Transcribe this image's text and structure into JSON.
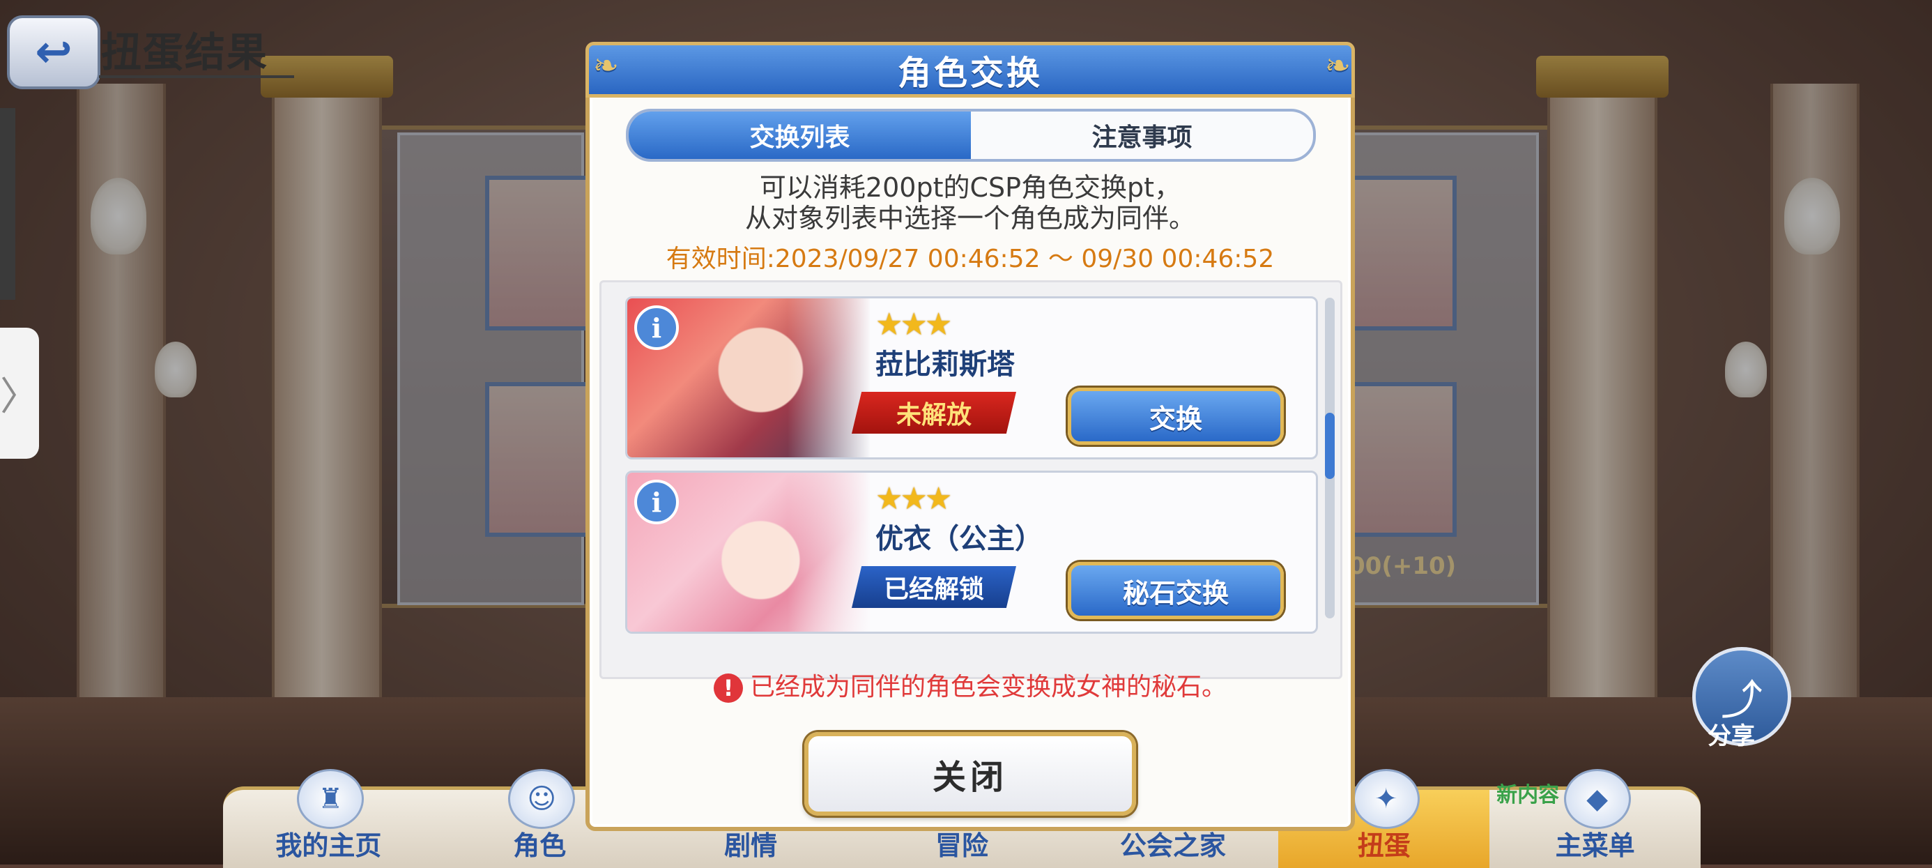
{
  "header": {
    "scene_title": "扭蛋结果",
    "back_icon": "back-arrow-icon"
  },
  "modal": {
    "title": "角色交换",
    "tabs": [
      {
        "label": "交换列表",
        "active": true
      },
      {
        "label": "注意事项",
        "active": false
      }
    ],
    "description_line1": "可以消耗200pt的CSP角色交换pt，",
    "description_line2": "从对象列表中选择一个角色成为同伴。",
    "period": "有效时间:2023/09/27  00:46:52  ～  09/30  00:46:52",
    "items": [
      {
        "stars": "★★★",
        "name": "菈比莉斯塔",
        "status": "未解放",
        "action": "交换",
        "info": "i"
      },
      {
        "stars": "★★★",
        "name": "优衣（公主）",
        "status": "已经解锁",
        "action": "秘石交换",
        "info": "i"
      }
    ],
    "notice_mark": "!",
    "notice": "已经成为同伴的角色会变换成女神的秘石。",
    "close_label": "关闭"
  },
  "side": {
    "share_label": "分享",
    "handle_glyph": "〉",
    "background_label": "00(+10)"
  },
  "bottom_nav": [
    {
      "label": "我的主页",
      "icon": "castle-icon",
      "active": false
    },
    {
      "label": "角色",
      "icon": "character-icon",
      "active": false
    },
    {
      "label": "剧情",
      "icon": "story-icon",
      "active": false
    },
    {
      "label": "冒险",
      "icon": "adventure-icon",
      "active": false
    },
    {
      "label": "公会之家",
      "icon": "guild-icon",
      "active": false
    },
    {
      "label": "扭蛋",
      "icon": "gacha-icon",
      "active": true
    },
    {
      "label": "主菜单",
      "icon": "menu-icon",
      "active": false
    }
  ],
  "badges": {
    "new_content": "新内容"
  },
  "colors": {
    "accent_blue": "#2a69c6",
    "gold_border": "#c9a35a",
    "period_orange": "#d67a12",
    "notice_red": "#e03a3a",
    "locked_red": "#a3130e",
    "unlocked_blue": "#173f8e"
  }
}
